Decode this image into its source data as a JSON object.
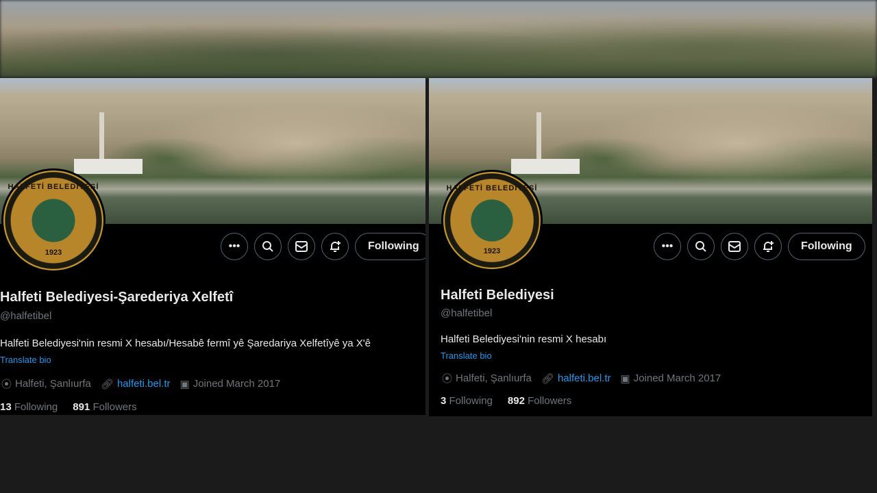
{
  "colors": {
    "accent": "#1d9bf0",
    "background": "#000000",
    "text": "#e7e9ea",
    "muted": "#71767b"
  },
  "avatar": {
    "logo_text": "HALFETİ BELEDİYESİ",
    "year": "1923"
  },
  "left": {
    "name": "Halfeti Belediyesi-Şarederiya Xelfetî",
    "handle": "@halfetibel",
    "bio": "Halfeti Belediyesi'nin resmi X hesabı/Hesabê fermî yê Şaredariya Xelfetîyê ya X'ê",
    "translate": "Translate bio",
    "location": "Halfeti, Şanlıurfa",
    "website": "halfeti.bel.tr",
    "joined": "Joined March 2017",
    "following_count": "13",
    "following_label": "Following",
    "followers_count": "891",
    "followers_label": "Followers",
    "follow_button": "Following"
  },
  "right": {
    "name": "Halfeti Belediyesi",
    "handle": "@halfetibel",
    "bio": "Halfeti Belediyesi'nin resmi X hesabı",
    "translate": "Translate bio",
    "location": "Halfeti, Şanlıurfa",
    "website": "halfeti.bel.tr",
    "joined": "Joined March 2017",
    "following_count": "3",
    "following_label": "Following",
    "followers_count": "892",
    "followers_label": "Followers",
    "follow_button": "Following"
  },
  "icons": [
    "more-icon",
    "search-icon",
    "mail-icon",
    "bell-plus-icon",
    "location-icon",
    "link-icon",
    "calendar-icon"
  ]
}
